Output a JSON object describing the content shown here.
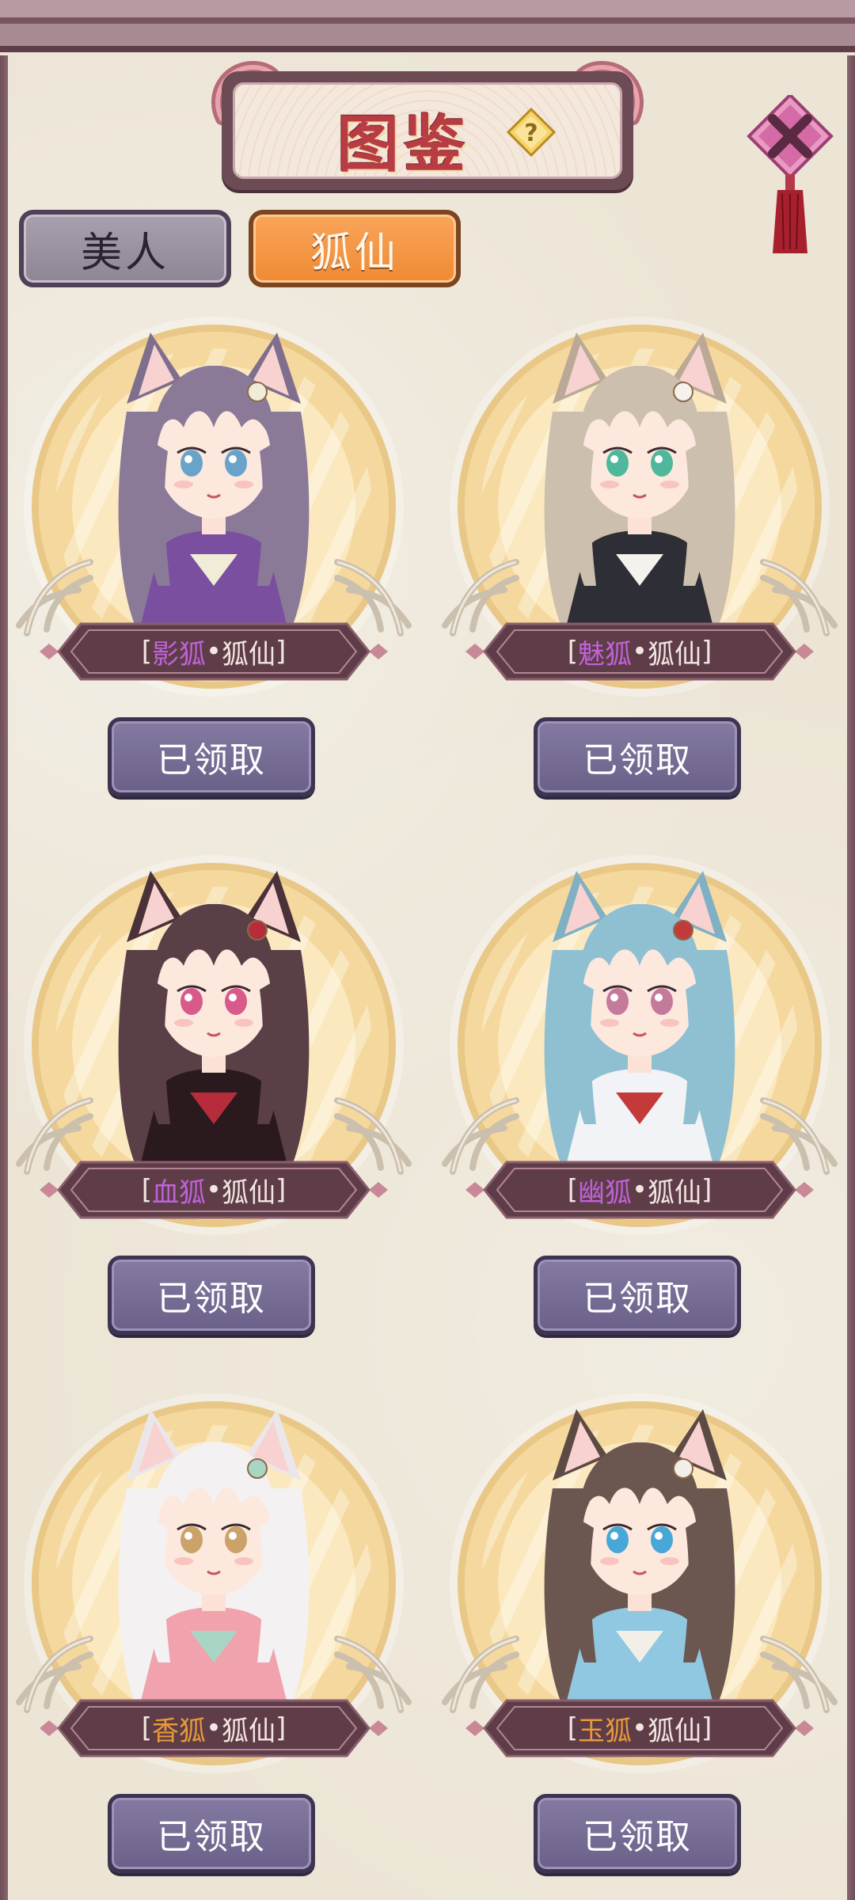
{
  "header": {
    "title": "图鉴",
    "help_icon": "question-diamond-icon",
    "close_icon": "close-knot-ornament-icon"
  },
  "tabs": [
    {
      "label": "美人",
      "active": false
    },
    {
      "label": "狐仙",
      "active": true
    }
  ],
  "colors": {
    "accent": "#f08a33",
    "title_red": "#b83c44",
    "button": "#6b6089",
    "banner": "#6d4b55",
    "purple_name": "#b45ad1",
    "orange_name": "#e89a3a"
  },
  "cards": [
    {
      "prefix": "影狐",
      "sep": "•",
      "suffix": "狐仙",
      "prefix_color": "#c062d8",
      "button": "已领取",
      "palette": {
        "hair": "#8a7a98",
        "ear": "#7f6e8e",
        "outfit": "#7a4fa0",
        "accent": "#f1ecd8",
        "eyes": "#6aa3c9"
      }
    },
    {
      "prefix": "魅狐",
      "sep": "•",
      "suffix": "狐仙",
      "prefix_color": "#c062d8",
      "button": "已领取",
      "palette": {
        "hair": "#cdbfae",
        "ear": "#b9a996",
        "outfit": "#2e2e36",
        "accent": "#f5f2ee",
        "eyes": "#4fb89a"
      }
    },
    {
      "prefix": "血狐",
      "sep": "•",
      "suffix": "狐仙",
      "prefix_color": "#c062d8",
      "button": "已领取",
      "palette": {
        "hair": "#5a4046",
        "ear": "#4a3238",
        "outfit": "#2a1a1e",
        "accent": "#b62c3a",
        "eyes": "#d85a8a"
      }
    },
    {
      "prefix": "幽狐",
      "sep": "•",
      "suffix": "狐仙",
      "prefix_color": "#c062d8",
      "button": "已领取",
      "palette": {
        "hair": "#8fc0d2",
        "ear": "#7fb0c4",
        "outfit": "#f1f3f6",
        "accent": "#c23a3a",
        "eyes": "#c47a9a"
      }
    },
    {
      "prefix": "香狐",
      "sep": "•",
      "suffix": "狐仙",
      "prefix_color": "#e89a3a",
      "button": "已领取",
      "palette": {
        "hair": "#f3f1f2",
        "ear": "#ebe6ea",
        "outfit": "#f0a3ad",
        "accent": "#a9d6c4",
        "eyes": "#caa26a"
      }
    },
    {
      "prefix": "玉狐",
      "sep": "•",
      "suffix": "狐仙",
      "prefix_color": "#e89a3a",
      "button": "已领取",
      "palette": {
        "hair": "#6b5750",
        "ear": "#5e4a44",
        "outfit": "#8fc8e0",
        "accent": "#f2efe8",
        "eyes": "#47a7d6"
      }
    }
  ]
}
